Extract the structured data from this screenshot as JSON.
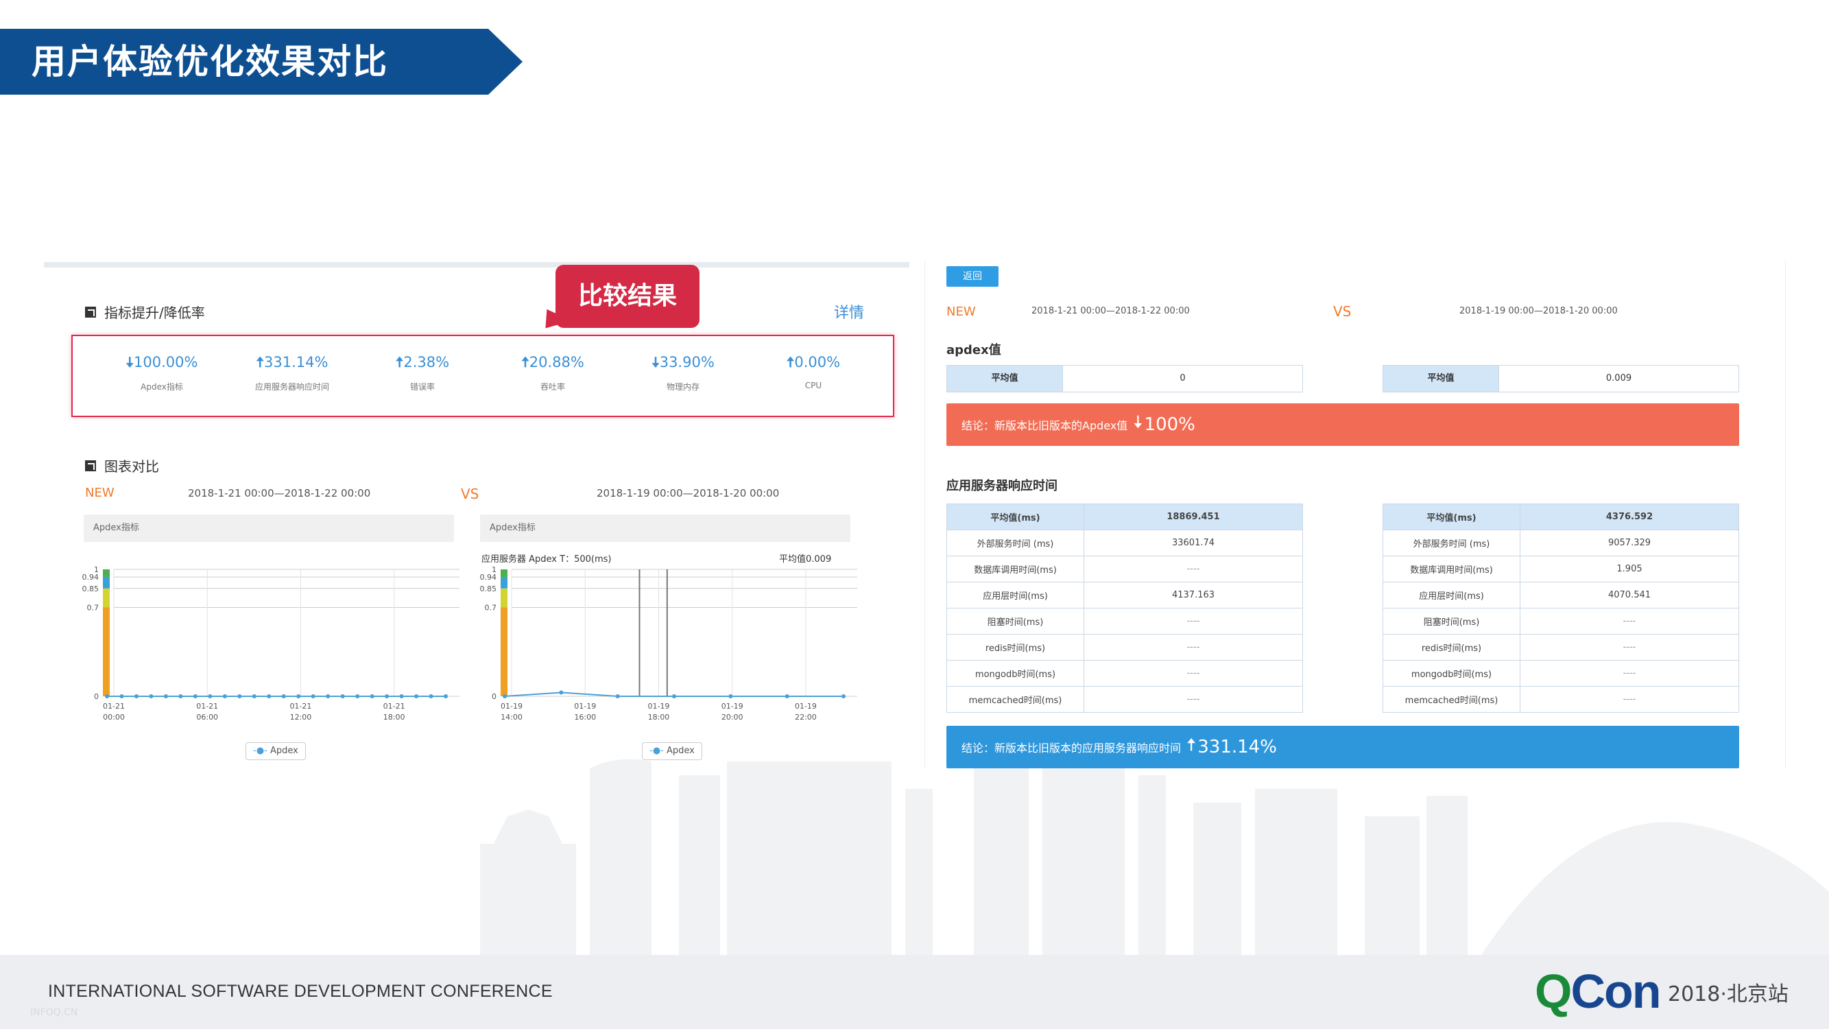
{
  "slide": {
    "title": "用户体验优化效果对比",
    "footer_left": "INTERNATIONAL SOFTWARE DEVELOPMENT CONFERENCE",
    "footer_sub": "INFOQ.CN",
    "logo_q": "Q",
    "logo_con": "Con",
    "logo_year": "2018·北京站"
  },
  "left": {
    "metrics_title": "指标提升/降低率",
    "detail_link": "详情",
    "callout": "比较结果",
    "metrics": [
      {
        "arrow": "down",
        "arrow_glyph": "🠇",
        "value": "100.00%",
        "label": "Apdex指标"
      },
      {
        "arrow": "up",
        "arrow_glyph": "🠅",
        "value": "331.14%",
        "label": "应用服务器响应时间"
      },
      {
        "arrow": "up",
        "arrow_glyph": "🠅",
        "value": "2.38%",
        "label": "错误率"
      },
      {
        "arrow": "up",
        "arrow_glyph": "🠅",
        "value": "20.88%",
        "label": "吞吐率"
      },
      {
        "arrow": "down",
        "arrow_glyph": "🠇",
        "value": "33.90%",
        "label": "物理内存"
      },
      {
        "arrow": "up",
        "arrow_glyph": "🠅",
        "value": "0.00%",
        "label": "CPU"
      }
    ],
    "compare_title": "图表对比",
    "new_tag": "NEW",
    "new_range": "2018-1-21 00:00—2018-1-22 00:00",
    "vs_tag": "VS",
    "old_range": "2018-1-19 00:00—2018-1-20 00:00",
    "chart1_head": "Apdex指标",
    "chart2_head": "Apdex指标",
    "chart2_info": "应用服务器 Apdex T：500(ms)",
    "chart2_avg": "平均值0.009",
    "legend": "Apdex"
  },
  "right": {
    "back": "返回",
    "new_tag": "NEW",
    "new_range": "2018-1-21 00:00—2018-1-22 00:00",
    "vs_tag": "VS",
    "old_range": "2018-1-19 00:00—2018-1-20 00:00",
    "apdex_title": "apdex值",
    "avg_label": "平均值",
    "apdex_new": "0",
    "apdex_old": "0.009",
    "apdex_conclusion": "结论：新版本比旧版本的Apdex值",
    "apdex_conclusion_glyph": "🠇",
    "apdex_conclusion_val": "100%",
    "resp_title": "应用服务器响应时间",
    "resp_head_label": "平均值(ms)",
    "resp_new_avg": "18869.451",
    "resp_old_avg": "4376.592",
    "rows": [
      {
        "label": "外部服务时间 (ms)",
        "new": "33601.74",
        "old": "9057.329"
      },
      {
        "label": "数据库调用时间(ms)",
        "new": "----",
        "old": "1.905"
      },
      {
        "label": "应用层时间(ms)",
        "new": "4137.163",
        "old": "4070.541"
      },
      {
        "label": "阻塞时间(ms)",
        "new": "----",
        "old": "----"
      },
      {
        "label": "redis时间(ms)",
        "new": "----",
        "old": "----"
      },
      {
        "label": "mongodb时间(ms)",
        "new": "----",
        "old": "----"
      },
      {
        "label": "memcached时间(ms)",
        "new": "----",
        "old": "----"
      }
    ],
    "resp_conclusion": "结论：新版本比旧版本的应用服务器响应时间",
    "resp_conclusion_glyph": "🠅",
    "resp_conclusion_val": "331.14%"
  },
  "chart_data": [
    {
      "type": "line",
      "title": "Apdex指标",
      "x": [
        "01-21 00:00",
        "01-21 06:00",
        "01-21 12:00",
        "01-21 18:00"
      ],
      "series": [
        {
          "name": "Apdex",
          "values": [
            0,
            0,
            0,
            0
          ]
        }
      ],
      "y_ticks": [
        0,
        0.7,
        0.85,
        0.94,
        1
      ],
      "ylim": [
        0,
        1
      ],
      "bands": [
        {
          "from": 0,
          "to": 0.7,
          "color": "#f0a020"
        },
        {
          "from": 0.7,
          "to": 0.85,
          "color": "#d4d430"
        },
        {
          "from": 0.85,
          "to": 0.94,
          "color": "#3aa0d8"
        },
        {
          "from": 0.94,
          "to": 1,
          "color": "#4cb050"
        }
      ],
      "grid": true,
      "legend": "bottom"
    },
    {
      "type": "line",
      "title": "Apdex指标",
      "x": [
        "01-19 14:00",
        "01-19 16:00",
        "01-19 18:00",
        "01-19 20:00",
        "01-19 22:00"
      ],
      "series": [
        {
          "name": "Apdex",
          "values": [
            0,
            0.03,
            0,
            0,
            0,
            0,
            0
          ]
        }
      ],
      "y_ticks": [
        0,
        0.7,
        0.85,
        0.94,
        1
      ],
      "ylim": [
        0,
        1
      ],
      "grid": true,
      "legend": "bottom"
    }
  ]
}
